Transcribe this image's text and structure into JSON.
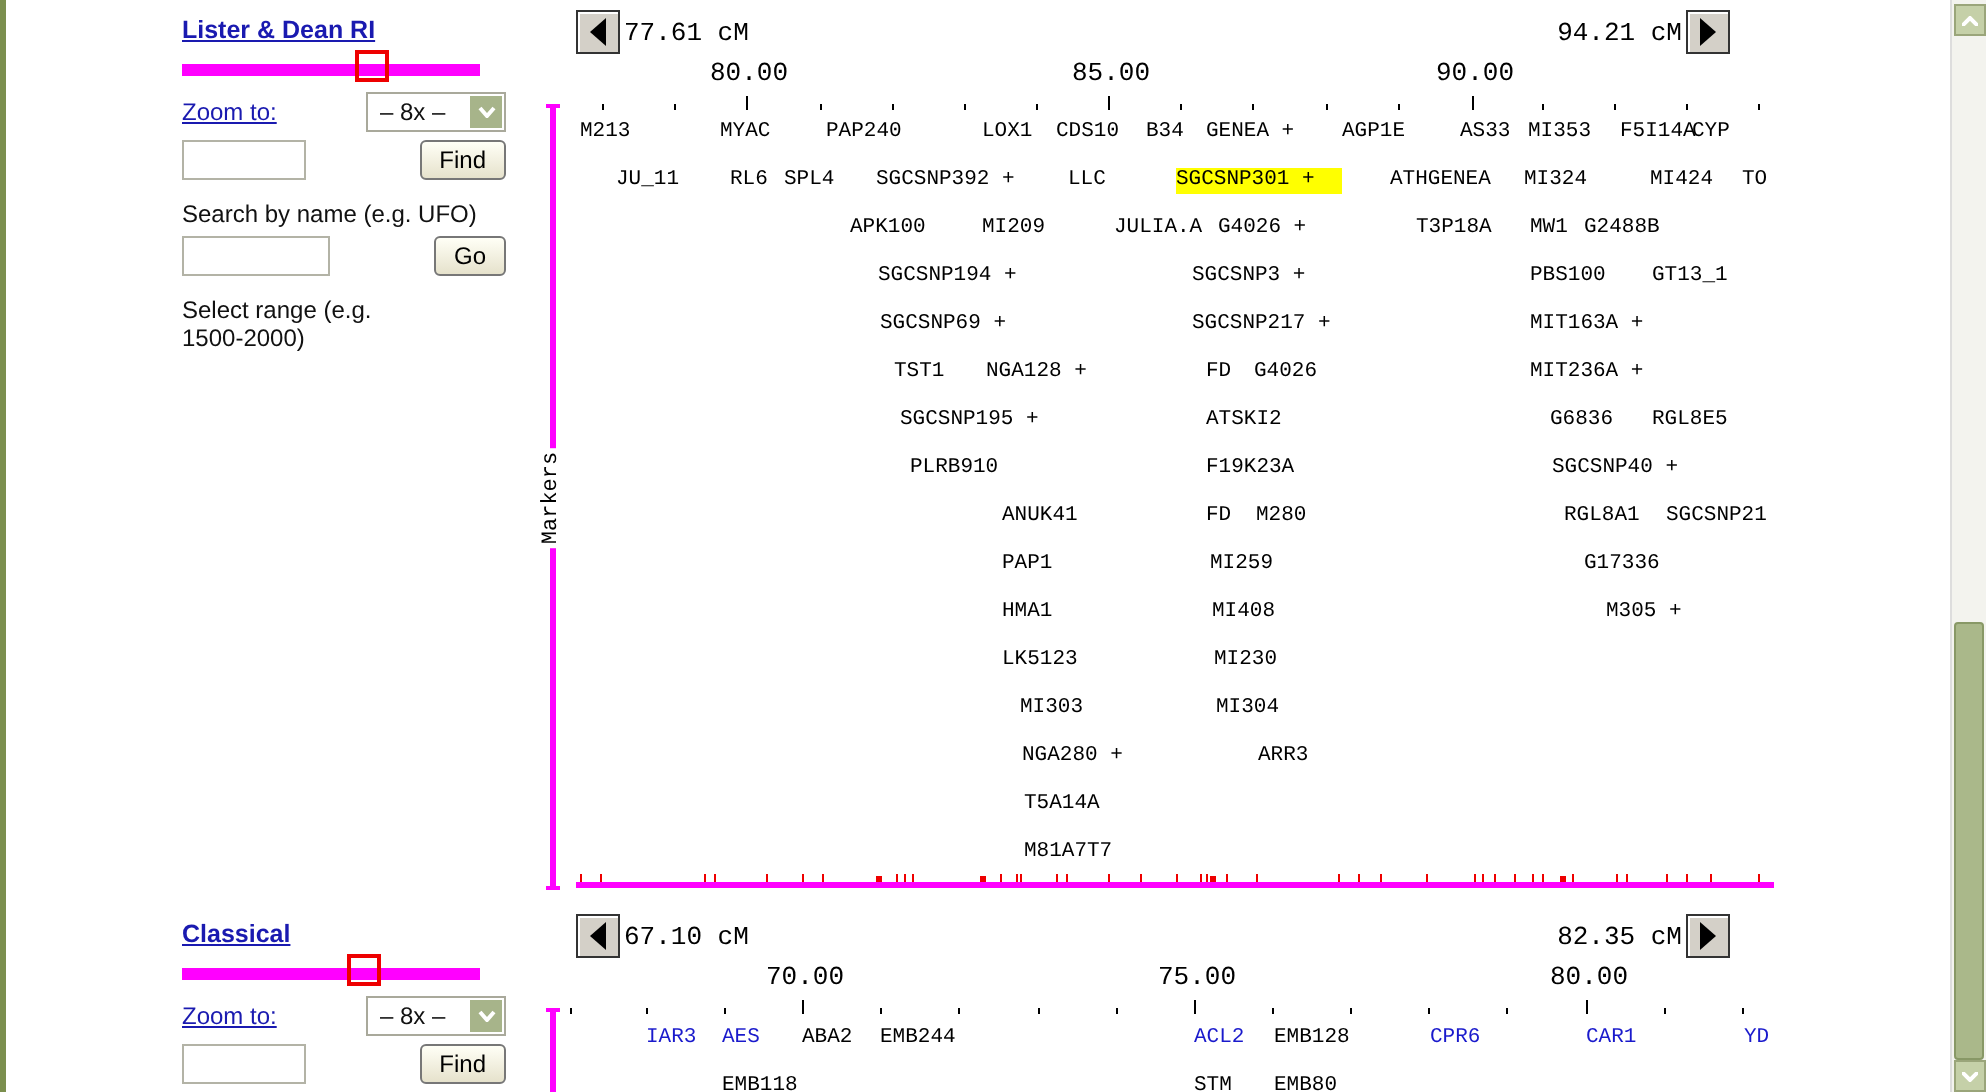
{
  "maps": [
    {
      "title": "Lister & Dean RI",
      "slider": {
        "level": 0.64
      },
      "zoom_label": "Zoom to:",
      "zoom_value": "– 8x –",
      "find_button": "Find",
      "search_hint": "Search by name (e.g. UFO)",
      "go_button": "Go",
      "range_hint": "Select range (e.g. 1500-2000)",
      "range_start": "77.61 cM",
      "range_end": "94.21 cM",
      "axis_labels": [
        "80.00",
        "85.00",
        "90.00"
      ],
      "track_label": "Markers",
      "marker_rows": [
        [
          {
            "label": "M213",
            "selected": false
          },
          {
            "label": "MYAC",
            "selected": false
          },
          {
            "label": "PAP240",
            "selected": false
          },
          {
            "label": "LOX1",
            "selected": false
          },
          {
            "label": "CDS10",
            "selected": false
          },
          {
            "label": "B34",
            "selected": false
          },
          {
            "label": "GENEA +",
            "selected": false
          },
          {
            "label": "AGP1E",
            "selected": false
          },
          {
            "label": "AS33",
            "selected": false
          },
          {
            "label": "MI353",
            "selected": false
          },
          {
            "label": "F5I14A",
            "selected": false
          },
          {
            "label": "CYP",
            "selected": false
          }
        ],
        [
          {
            "label": "JU_11",
            "selected": false
          },
          {
            "label": "RL6",
            "selected": false
          },
          {
            "label": "SPL4",
            "selected": false
          },
          {
            "label": "SGCSNP392 +",
            "selected": false
          },
          {
            "label": "LLC",
            "selected": false
          },
          {
            "label": "SGCSNP301 +",
            "selected": true
          },
          {
            "label": "ATHGENEA",
            "selected": false
          },
          {
            "label": "MI324",
            "selected": false
          },
          {
            "label": "MI424",
            "selected": false
          },
          {
            "label": "TO",
            "selected": false
          }
        ],
        [
          {
            "label": "APK100",
            "selected": false
          },
          {
            "label": "MI209",
            "selected": false
          },
          {
            "label": "JULIA.A",
            "selected": false
          },
          {
            "label": "G4026 +",
            "selected": false
          },
          {
            "label": "T3P18A",
            "selected": false
          },
          {
            "label": "MW1",
            "selected": false
          },
          {
            "label": "G2488B",
            "selected": false
          }
        ],
        [
          {
            "label": "SGCSNP194 +",
            "selected": false
          },
          {
            "label": "SGCSNP3 +",
            "selected": false
          },
          {
            "label": "PBS100",
            "selected": false
          },
          {
            "label": "GT13_1",
            "selected": false
          }
        ],
        [
          {
            "label": "SGCSNP69 +",
            "selected": false
          },
          {
            "label": "SGCSNP217 +",
            "selected": false
          },
          {
            "label": "MIT163A +",
            "selected": false
          }
        ],
        [
          {
            "label": "TST1",
            "selected": false
          },
          {
            "label": "NGA128 +",
            "selected": false
          },
          {
            "label": "FD",
            "selected": false
          },
          {
            "label": "G4026",
            "selected": false
          },
          {
            "label": "MIT236A +",
            "selected": false
          }
        ],
        [
          {
            "label": "SGCSNP195 +",
            "selected": false
          },
          {
            "label": "ATSKI2",
            "selected": false
          },
          {
            "label": "G6836",
            "selected": false
          },
          {
            "label": "RGL8E5",
            "selected": false
          }
        ],
        [
          {
            "label": "PLRB910",
            "selected": false
          },
          {
            "label": "F19K23A",
            "selected": false
          },
          {
            "label": "SGCSNP40 +",
            "selected": false
          }
        ],
        [
          {
            "label": "ANUK41",
            "selected": false
          },
          {
            "label": "FD",
            "selected": false
          },
          {
            "label": "M280",
            "selected": false
          },
          {
            "label": "RGL8A1",
            "selected": false
          },
          {
            "label": "SGCSNP21",
            "selected": false
          }
        ],
        [
          {
            "label": "PAP1",
            "selected": false
          },
          {
            "label": "MI259",
            "selected": false
          },
          {
            "label": "G17336",
            "selected": false
          }
        ],
        [
          {
            "label": "HMA1",
            "selected": false
          },
          {
            "label": "MI408",
            "selected": false
          },
          {
            "label": "M305 +",
            "selected": false
          }
        ],
        [
          {
            "label": "LK5123",
            "selected": false
          },
          {
            "label": "MI230",
            "selected": false
          }
        ],
        [
          {
            "label": "MI303",
            "selected": false
          },
          {
            "label": "MI304",
            "selected": false
          }
        ],
        [
          {
            "label": "NGA280 +",
            "selected": false
          },
          {
            "label": "ARR3",
            "selected": false
          }
        ],
        [
          {
            "label": "T5A14A",
            "selected": false
          }
        ],
        [
          {
            "label": "M81A7T7",
            "selected": false
          }
        ]
      ]
    },
    {
      "title": "Classical",
      "slider": {
        "level": 0.61
      },
      "zoom_label": "Zoom to:",
      "zoom_value": "– 8x –",
      "find_button": "Find",
      "range_start": "67.10 cM",
      "range_end": "82.35 cM",
      "axis_labels": [
        "70.00",
        "75.00",
        "80.00"
      ],
      "marker_rows": [
        [
          {
            "label": "IAR3",
            "color": "#1a1acc"
          },
          {
            "label": "AES",
            "color": "#1a1acc"
          },
          {
            "label": "ABA2",
            "color": "#000000"
          },
          {
            "label": "EMB244",
            "color": "#000000"
          },
          {
            "label": "ACL2",
            "color": "#1a1acc"
          },
          {
            "label": "EMB128",
            "color": "#000000"
          },
          {
            "label": "CPR6",
            "color": "#1a1acc"
          },
          {
            "label": "CAR1",
            "color": "#1a1acc"
          },
          {
            "label": "YD",
            "color": "#1a1acc"
          }
        ],
        [
          {
            "label": "EMB118",
            "color": "#000000"
          },
          {
            "label": "STM",
            "color": "#000000"
          },
          {
            "label": "EMB80",
            "color": "#000000"
          }
        ]
      ]
    }
  ]
}
